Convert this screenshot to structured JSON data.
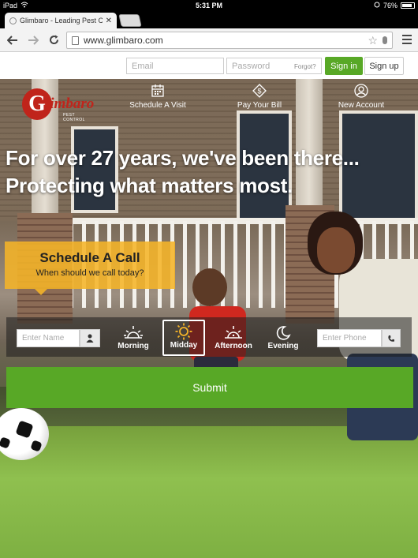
{
  "status_bar": {
    "device": "iPad",
    "time": "5:31 PM",
    "battery": "76%"
  },
  "browser": {
    "tab_title": "Glimbaro - Leading Pest C",
    "url": "www.glimbaro.com"
  },
  "site_header": {
    "email_placeholder": "Email",
    "password_placeholder": "Password",
    "forgot_label": "Forgot?",
    "sign_in_label": "Sign in",
    "sign_up_label": "Sign up"
  },
  "logo": {
    "initial": "G",
    "rest": "limbaro",
    "tagline": "PEST CONTROL"
  },
  "nav": {
    "items": [
      {
        "label": "Schedule A Visit",
        "icon": "calendar-icon"
      },
      {
        "label": "Pay Your Bill",
        "icon": "dollar-tag-icon"
      },
      {
        "label": "New Account",
        "icon": "user-circle-icon"
      }
    ]
  },
  "hero": {
    "headline_line1": "For over 27 years, we've been there...",
    "headline_line2": "Protecting what matters most."
  },
  "schedule": {
    "title": "Schedule A Call",
    "subtitle": "When should we call today?",
    "name_placeholder": "Enter Name",
    "phone_placeholder": "Enter Phone",
    "time_options": [
      {
        "label": "Morning",
        "icon": "sunrise-icon",
        "selected": false
      },
      {
        "label": "Midday",
        "icon": "sun-icon",
        "selected": true
      },
      {
        "label": "Afternoon",
        "icon": "sunset-icon",
        "selected": false
      },
      {
        "label": "Evening",
        "icon": "moon-icon",
        "selected": false
      }
    ],
    "submit_label": "Submit"
  },
  "colors": {
    "brand_green": "#58a826",
    "brand_red": "#c0241b",
    "schedule_yellow": "#f5b428"
  }
}
